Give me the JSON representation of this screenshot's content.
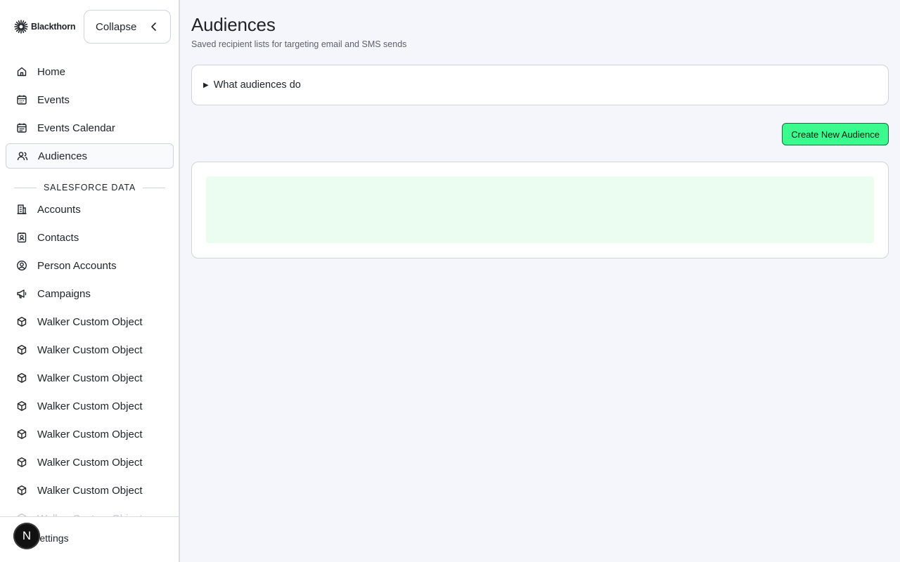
{
  "app": {
    "brand": "Blackthorn",
    "collapse_label": "Collapse"
  },
  "sidebar": {
    "items": [
      {
        "label": "Home",
        "icon": "home-icon"
      },
      {
        "label": "Events",
        "icon": "calendar-icon"
      },
      {
        "label": "Events Calendar",
        "icon": "calendar-grid-icon"
      },
      {
        "label": "Audiences",
        "icon": "users-icon",
        "active": true
      }
    ],
    "section_label": "SALESFORCE DATA",
    "data_items": [
      {
        "label": "Accounts",
        "icon": "building-icon"
      },
      {
        "label": "Contacts",
        "icon": "contact-card-icon"
      },
      {
        "label": "Person Accounts",
        "icon": "user-circle-icon"
      },
      {
        "label": "Campaigns",
        "icon": "megaphone-icon"
      },
      {
        "label": "Walker Custom Object",
        "icon": "cube-icon"
      },
      {
        "label": "Walker Custom Object",
        "icon": "cube-icon"
      },
      {
        "label": "Walker Custom Object",
        "icon": "cube-icon"
      },
      {
        "label": "Walker Custom Object",
        "icon": "cube-icon"
      },
      {
        "label": "Walker Custom Object",
        "icon": "cube-icon"
      },
      {
        "label": "Walker Custom Object",
        "icon": "cube-icon"
      },
      {
        "label": "Walker Custom Object",
        "icon": "cube-icon"
      },
      {
        "label": "Walker Custom Object",
        "icon": "cube-icon"
      }
    ],
    "footer": {
      "settings_label": "Settings",
      "avatar_initial": "N"
    }
  },
  "main": {
    "title": "Audiences",
    "subtitle": "Saved recipient lists for targeting email and SMS sends",
    "details_summary": "What audiences do",
    "create_button": "Create New Audience"
  },
  "colors": {
    "accent": "#3dfa8f",
    "skeleton": "#ebfdf0",
    "background": "#f5f6fb"
  }
}
